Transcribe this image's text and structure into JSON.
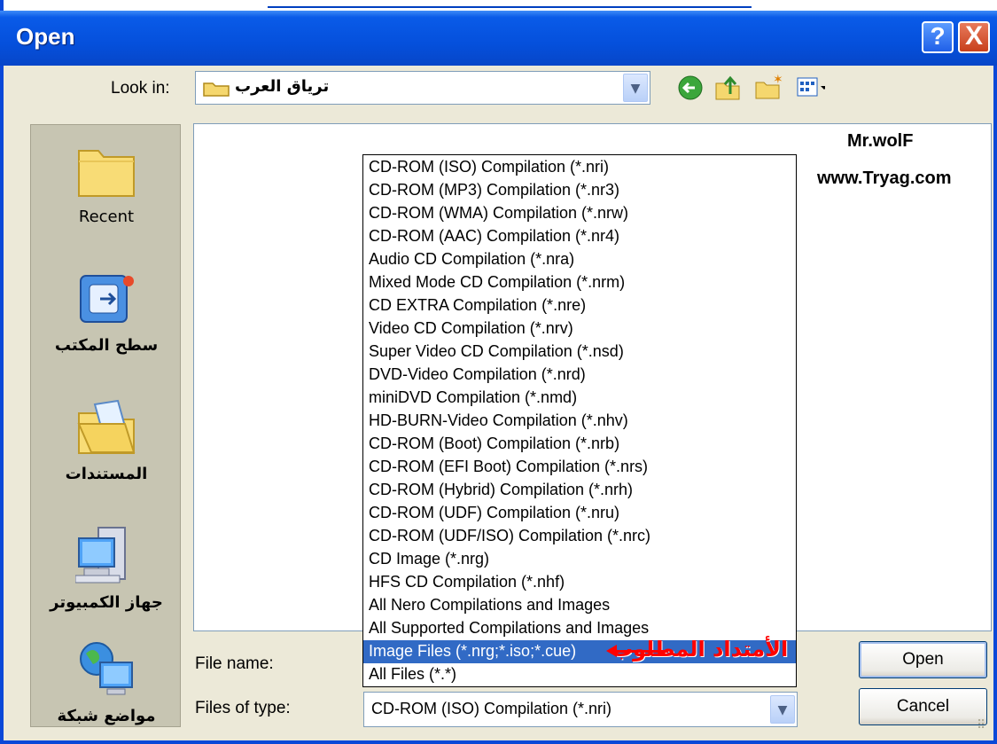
{
  "window": {
    "title": "Open",
    "help_label": "?",
    "close_label": "X"
  },
  "look_in": {
    "label": "Look in:",
    "value": "ترياق العرب"
  },
  "toolbar": {
    "icons": [
      "back-icon",
      "up-folder-icon",
      "new-folder-icon",
      "views-menu-icon"
    ]
  },
  "places": [
    {
      "label": "Recent",
      "icon": "recent-folder-icon"
    },
    {
      "label": "سطح المكتب",
      "icon": "desktop-icon"
    },
    {
      "label": "المستندات",
      "icon": "documents-folder-icon"
    },
    {
      "label": "جهاز الكمبيوتر",
      "icon": "my-computer-icon"
    },
    {
      "label": "مواضع شبكة",
      "icon": "network-places-icon"
    }
  ],
  "watermark": {
    "line1": "Mr.wolF",
    "line2": "www.Tryag.com"
  },
  "file_name": {
    "label": "File name:",
    "value": ""
  },
  "files_of_type": {
    "label": "Files of type:",
    "value": "CD-ROM (ISO) Compilation (*.nri)",
    "options": [
      "CD-ROM (ISO) Compilation (*.nri)",
      "CD-ROM (MP3) Compilation (*.nr3)",
      "CD-ROM (WMA) Compilation (*.nrw)",
      "CD-ROM (AAC) Compilation (*.nr4)",
      "Audio CD Compilation (*.nra)",
      "Mixed Mode CD Compilation (*.nrm)",
      "CD EXTRA Compilation (*.nre)",
      "Video CD Compilation (*.nrv)",
      "Super Video CD Compilation (*.nsd)",
      "DVD-Video Compilation (*.nrd)",
      "miniDVD Compilation (*.nmd)",
      "HD-BURN-Video Compilation (*.nhv)",
      "CD-ROM (Boot) Compilation (*.nrb)",
      "CD-ROM (EFI Boot) Compilation (*.nrs)",
      "CD-ROM (Hybrid) Compilation (*.nrh)",
      "CD-ROM (UDF) Compilation (*.nru)",
      "CD-ROM (UDF/ISO) Compilation (*.nrc)",
      "CD Image (*.nrg)",
      "HFS CD Compilation (*.nhf)",
      "All Nero Compilations and Images",
      "All Supported Compilations and Images",
      "Image Files (*.nrg;*.iso;*.cue)",
      "All Files (*.*)"
    ],
    "highlighted_index": 21
  },
  "annotation": {
    "text": "الأمتداد المطلوب"
  },
  "buttons": {
    "open": "Open",
    "cancel": "Cancel"
  },
  "colors": {
    "title_bar": "#0550DC",
    "selection": "#316AC5",
    "annotation": "#FF0000"
  }
}
